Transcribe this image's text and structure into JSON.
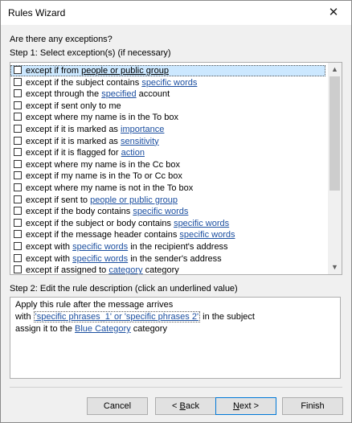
{
  "window": {
    "title": "Rules Wizard",
    "close_icon": "close-icon"
  },
  "question": "Are there any exceptions?",
  "step1": {
    "label": "Step 1: Select exception(s) (if necessary)",
    "items": [
      {
        "before": "except if from ",
        "link": "people or public group",
        "after": ""
      },
      {
        "before": "except if the subject contains ",
        "link": "specific words",
        "after": ""
      },
      {
        "before": "except through the ",
        "link": "specified",
        "after": " account"
      },
      {
        "before": "except if sent only to me",
        "link": "",
        "after": ""
      },
      {
        "before": "except where my name is in the To box",
        "link": "",
        "after": ""
      },
      {
        "before": "except if it is marked as ",
        "link": "importance",
        "after": ""
      },
      {
        "before": "except if it is marked as ",
        "link": "sensitivity",
        "after": ""
      },
      {
        "before": "except if it is flagged for ",
        "link": "action",
        "after": ""
      },
      {
        "before": "except where my name is in the Cc box",
        "link": "",
        "after": ""
      },
      {
        "before": "except if my name is in the To or Cc box",
        "link": "",
        "after": ""
      },
      {
        "before": "except where my name is not in the To box",
        "link": "",
        "after": ""
      },
      {
        "before": "except if sent to ",
        "link": "people or public group",
        "after": ""
      },
      {
        "before": "except if the body contains ",
        "link": "specific words",
        "after": ""
      },
      {
        "before": "except if the subject or body contains ",
        "link": "specific words",
        "after": ""
      },
      {
        "before": "except if the message header contains ",
        "link": "specific words",
        "after": ""
      },
      {
        "before": "except with ",
        "link": "specific words",
        "after": " in the recipient's address"
      },
      {
        "before": "except with ",
        "link": "specific words",
        "after": " in the sender's address"
      },
      {
        "before": "except if assigned to ",
        "link": "category",
        "after": " category"
      }
    ]
  },
  "step2": {
    "label": "Step 2: Edit the rule description (click an underlined value)",
    "line1": "Apply this rule after the message arrives",
    "line2_before": "with ",
    "line2_link": "'specific phrases_1' or 'specific phrases 2'",
    "line2_after": " in the subject",
    "line3_before": "assign it to the ",
    "line3_link": "Blue Category",
    "line3_after": " category"
  },
  "buttons": {
    "cancel": "Cancel",
    "back_prefix": "< ",
    "back_key": "B",
    "back_rest": "ack",
    "next_key": "N",
    "next_rest": "ext >",
    "finish": "Finish"
  }
}
